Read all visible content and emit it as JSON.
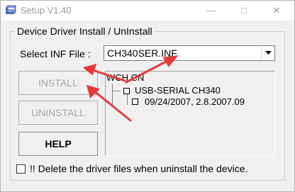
{
  "window": {
    "title": "Setup V1.40",
    "minimize": "—",
    "maximize": "□",
    "close": "✕"
  },
  "group": {
    "title": "Device Driver Install / UnInstall"
  },
  "inf": {
    "label": "Select INF File :",
    "value": "CH340SER.INF"
  },
  "buttons": {
    "install": "INSTALL",
    "uninstall": "UNINSTALL",
    "help": "HELP"
  },
  "tree": {
    "root": "WCH.CN",
    "items": [
      "USB-SERIAL CH340",
      "09/24/2007, 2.8.2007.09"
    ]
  },
  "option": {
    "label": "!! Delete the driver files when uninstall the device."
  },
  "annotation": {
    "arrow_color": "#e53a3a"
  },
  "icons": {
    "app": "installer-icon",
    "dropdown": "chevron-down-icon"
  }
}
